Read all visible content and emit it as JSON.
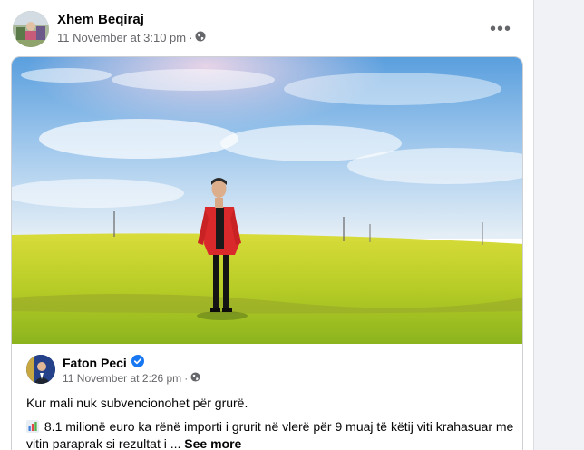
{
  "post": {
    "author": "Xhem Beqiraj",
    "timestamp": "11 November at 3:10 pm",
    "separator": "·",
    "audience_icon": "globe-icon",
    "more_label": "•••"
  },
  "shared_post": {
    "author": "Faton Peci",
    "verified_icon": "verified-badge-icon",
    "timestamp": "11 November at 2:26 pm",
    "separator": "·",
    "audience_icon": "globe-icon",
    "line1": "Kur mali nuk subvencionohet për grurë.",
    "line2_icon": "bar-chart-icon",
    "line2": "8.1 milionë euro ka rënë importi i grurit në vlerë për 9 muaj të këtij viti krahasuar me vitin paraprak si rezultat i ...",
    "see_more": "See more"
  },
  "colors": {
    "meta_text": "#65676b",
    "verified_blue": "#1877f2",
    "field_yellow": "#c9d82a",
    "jacket_red": "#d9292b"
  }
}
